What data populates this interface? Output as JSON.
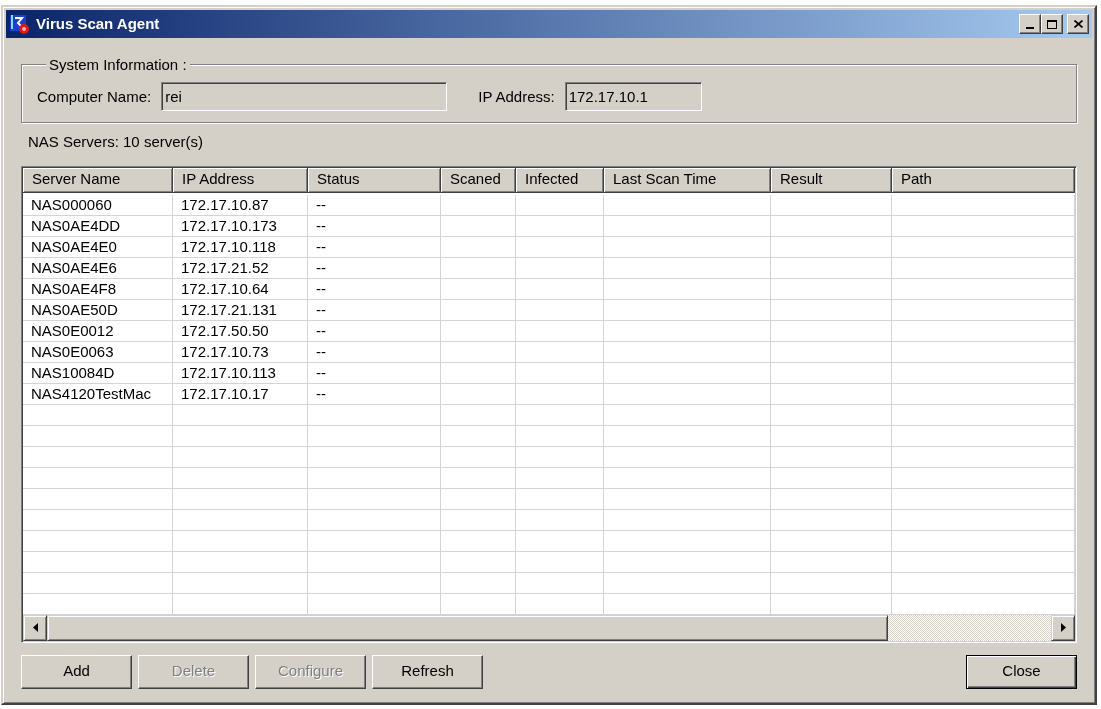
{
  "window": {
    "title": "Virus Scan Agent"
  },
  "system_information": {
    "title": "System Information :",
    "fields": [
      {
        "label": "Computer Name:",
        "value": "rei",
        "readonly": true
      },
      {
        "label": "IP Address:",
        "value": "172.17.10.1",
        "readonly": true
      }
    ]
  },
  "nas_servers": {
    "summary": "NAS Servers: 10 server(s)",
    "table": {
      "columns": [
        "Server Name",
        "IP Address",
        "Status",
        "Scaned",
        "Infected",
        "Last Scan Time",
        "Result",
        "Path"
      ],
      "rows": [
        {
          "server_name": "NAS000060",
          "ip_address": "172.17.10.87",
          "status": "--"
        },
        {
          "server_name": "NAS0AE4DD",
          "ip_address": "172.17.10.173",
          "status": "--"
        },
        {
          "server_name": "NAS0AE4E0",
          "ip_address": "172.17.10.118",
          "status": "--"
        },
        {
          "server_name": "NAS0AE4E6",
          "ip_address": "172.17.21.52",
          "status": "--"
        },
        {
          "server_name": "NAS0AE4F8",
          "ip_address": "172.17.10.64",
          "status": "--"
        },
        {
          "server_name": "NAS0AE50D",
          "ip_address": "172.17.21.131",
          "status": "--"
        },
        {
          "server_name": "NAS0E0012",
          "ip_address": "172.17.50.50",
          "status": "--"
        },
        {
          "server_name": "NAS0E0063",
          "ip_address": "172.17.10.73",
          "status": "--"
        },
        {
          "server_name": "NAS10084D",
          "ip_address": "172.17.10.113",
          "status": "--"
        },
        {
          "server_name": "NAS4120TestMac",
          "ip_address": "172.17.10.17",
          "status": "--"
        }
      ]
    }
  },
  "buttons": [
    {
      "label": "Add",
      "disabled": false
    },
    {
      "label": "Delete",
      "disabled": true
    },
    {
      "label": "Configure",
      "disabled": true
    },
    {
      "label": "Refresh",
      "disabled": false
    }
  ],
  "close_button": {
    "label": "Close",
    "default": true
  }
}
